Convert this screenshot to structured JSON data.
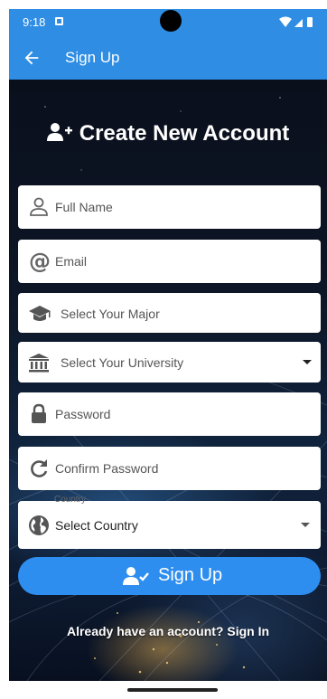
{
  "status_bar": {
    "time": "9:18"
  },
  "app_bar": {
    "title": "Sign Up"
  },
  "heading": "Create New Account",
  "fields": {
    "full_name": {
      "placeholder": "Full Name",
      "icon": "person-icon"
    },
    "email": {
      "placeholder": "Email",
      "icon": "at-icon"
    },
    "major": {
      "placeholder": "Select Your Major",
      "icon": "graduation-cap-icon"
    },
    "university": {
      "placeholder": "Select Your University",
      "icon": "university-icon"
    },
    "password": {
      "placeholder": "Password",
      "icon": "lock-icon"
    },
    "confirm_password": {
      "placeholder": "Confirm Password",
      "icon": "redo-icon"
    },
    "country": {
      "label": "Country",
      "value": "Select Country",
      "icon": "globe-icon"
    }
  },
  "signup_button": {
    "label": "Sign Up",
    "icon": "user-check-icon"
  },
  "signin_link": "Already have an account? Sign In",
  "colors": {
    "primary": "#2f8de4",
    "button": "#2e8ef0"
  }
}
